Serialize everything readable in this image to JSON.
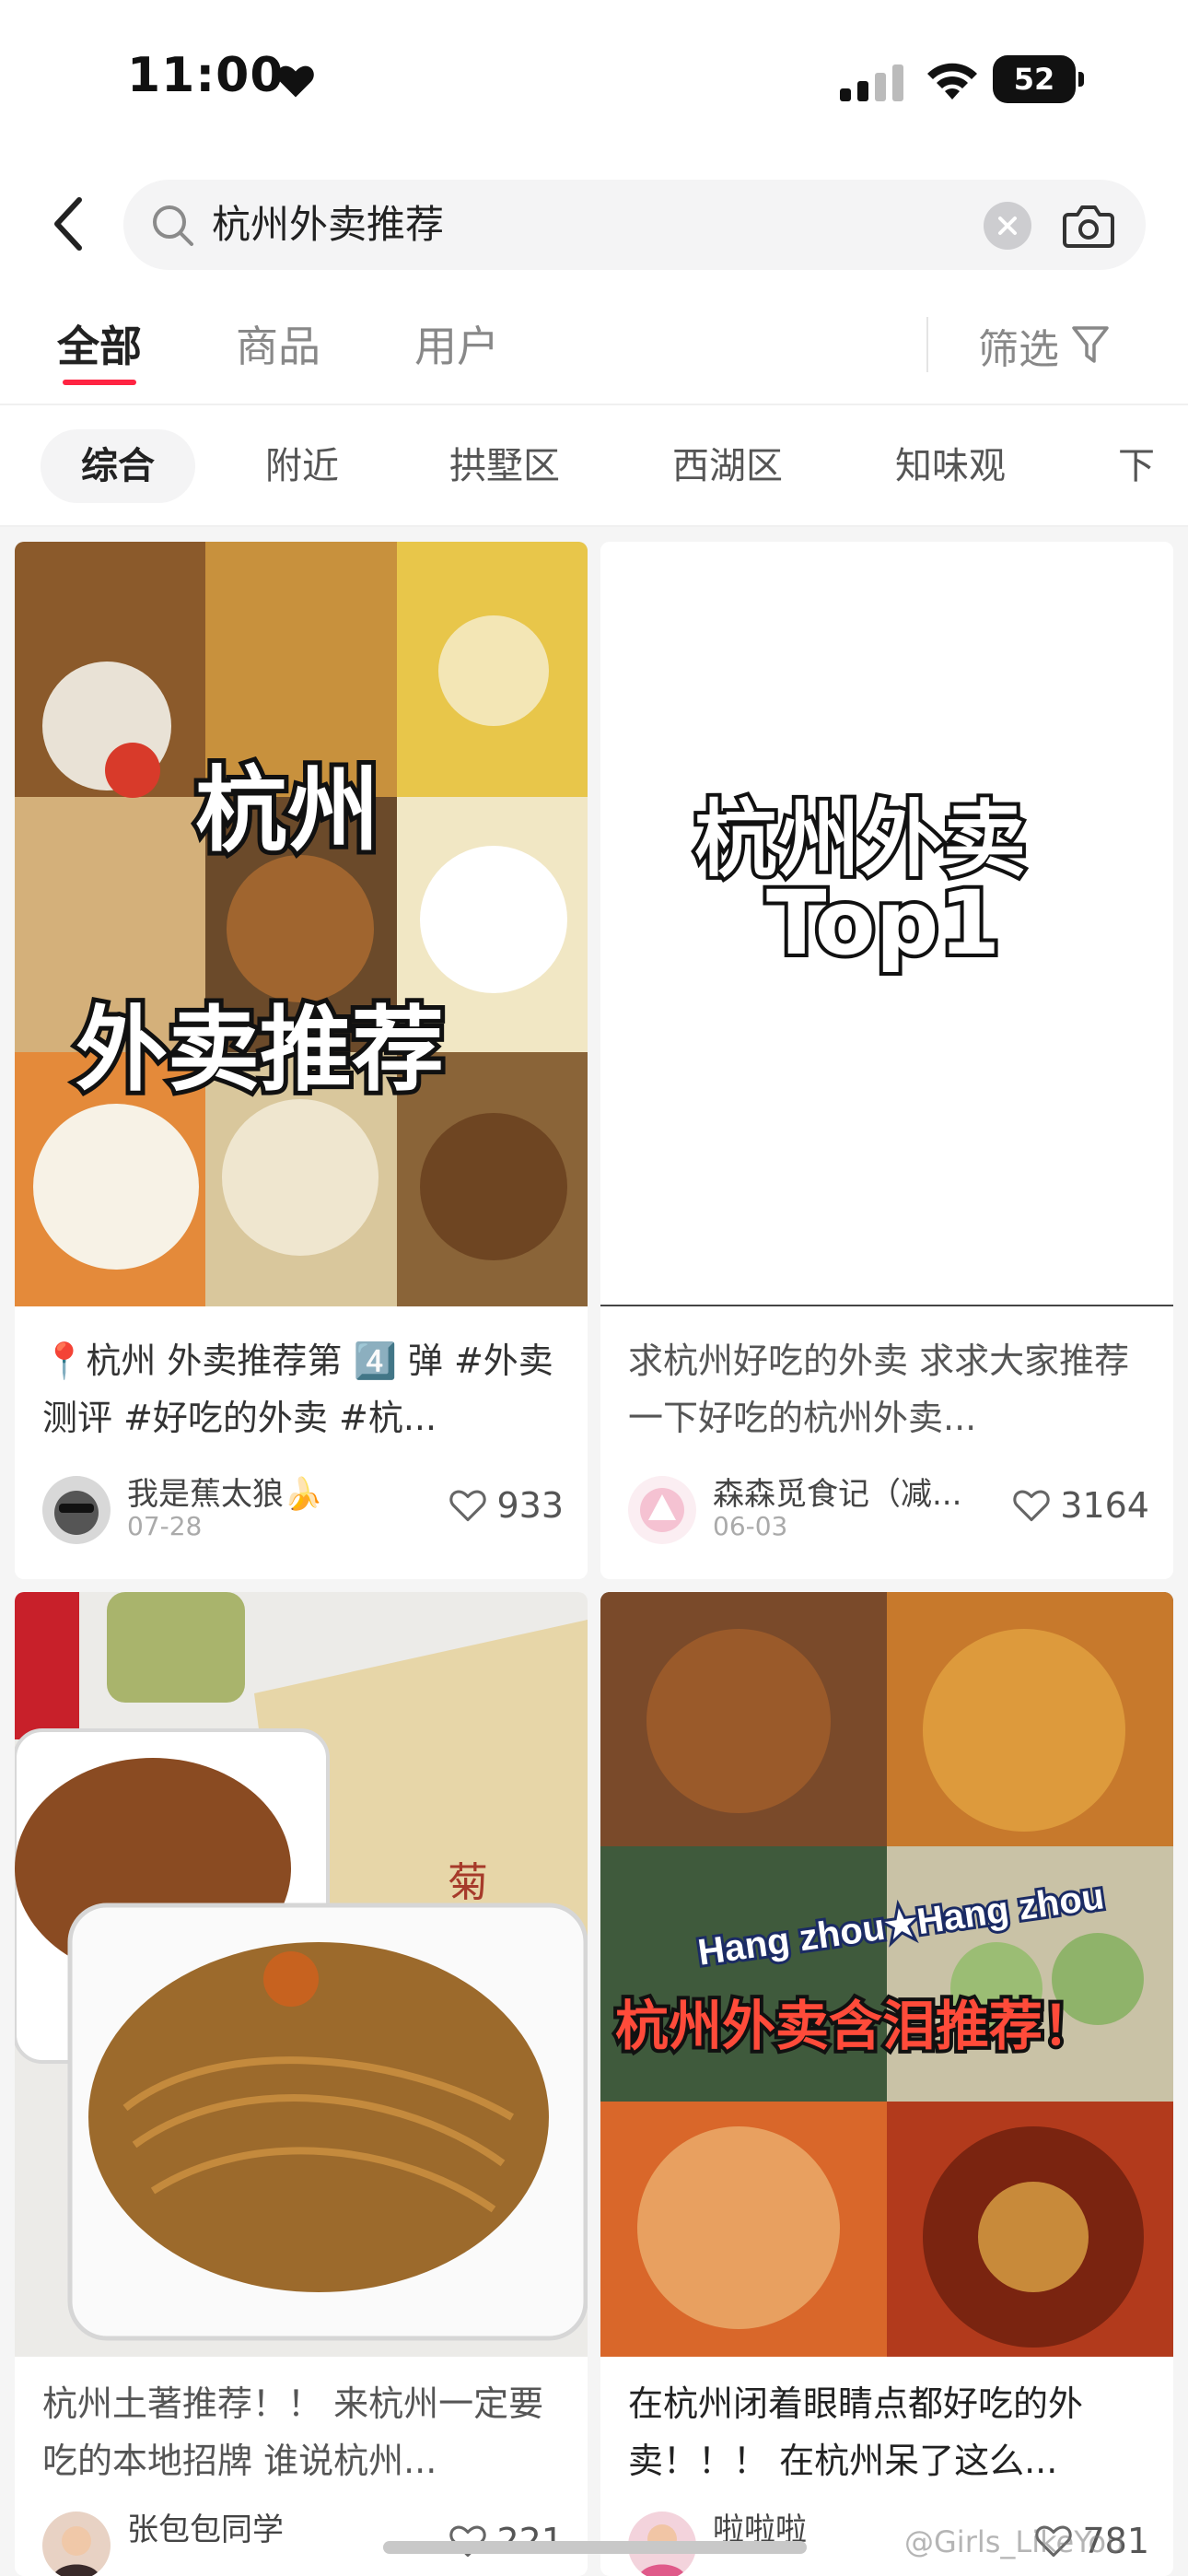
{
  "status_bar": {
    "time": "11:00",
    "battery": "52"
  },
  "search": {
    "query": "杭州外卖推荐"
  },
  "main_tabs": [
    {
      "label": "全部",
      "active": true
    },
    {
      "label": "商品",
      "active": false
    },
    {
      "label": "用户",
      "active": false
    }
  ],
  "filter_label": "筛选",
  "sub_tabs": [
    "综合",
    "附近",
    "拱墅区",
    "西湖区",
    "知味观",
    "下沙"
  ],
  "cards": [
    {
      "image_text_1": "杭州",
      "image_text_2": "外卖推荐",
      "title": "📍杭州 外卖推荐第 4️⃣ 弹 #外卖测评 #好吃的外卖 #杭...",
      "author": "我是蕉太狼🍌",
      "date": "07-28",
      "likes": "933"
    },
    {
      "image_text_1": "杭州外卖",
      "image_text_2": "Top1",
      "title": "求杭州好吃的外卖 求求大家推荐一下好吃的杭州外卖...",
      "author": "森森觅食记（减...",
      "date": "06-03",
      "likes": "3164"
    },
    {
      "title": "杭州土著推荐！！ 来杭州一定要吃的本地招牌 谁说杭州...",
      "author": "张包包同学",
      "likes": "221"
    },
    {
      "image_text_1": "Hang zhou★Hang zhou",
      "image_text_2": "杭州外卖含泪推荐！",
      "title": "在杭州闭着眼睛点都好吃的外卖！！！ 在杭州呆了这么...",
      "author": "啦啦啦",
      "likes": "781"
    }
  ],
  "watermark": "@Girls_LikeYou",
  "colors": {
    "accent": "#ff2442",
    "feed_bg": "#f5f5f5",
    "chip_bg": "#f4f4f5"
  }
}
